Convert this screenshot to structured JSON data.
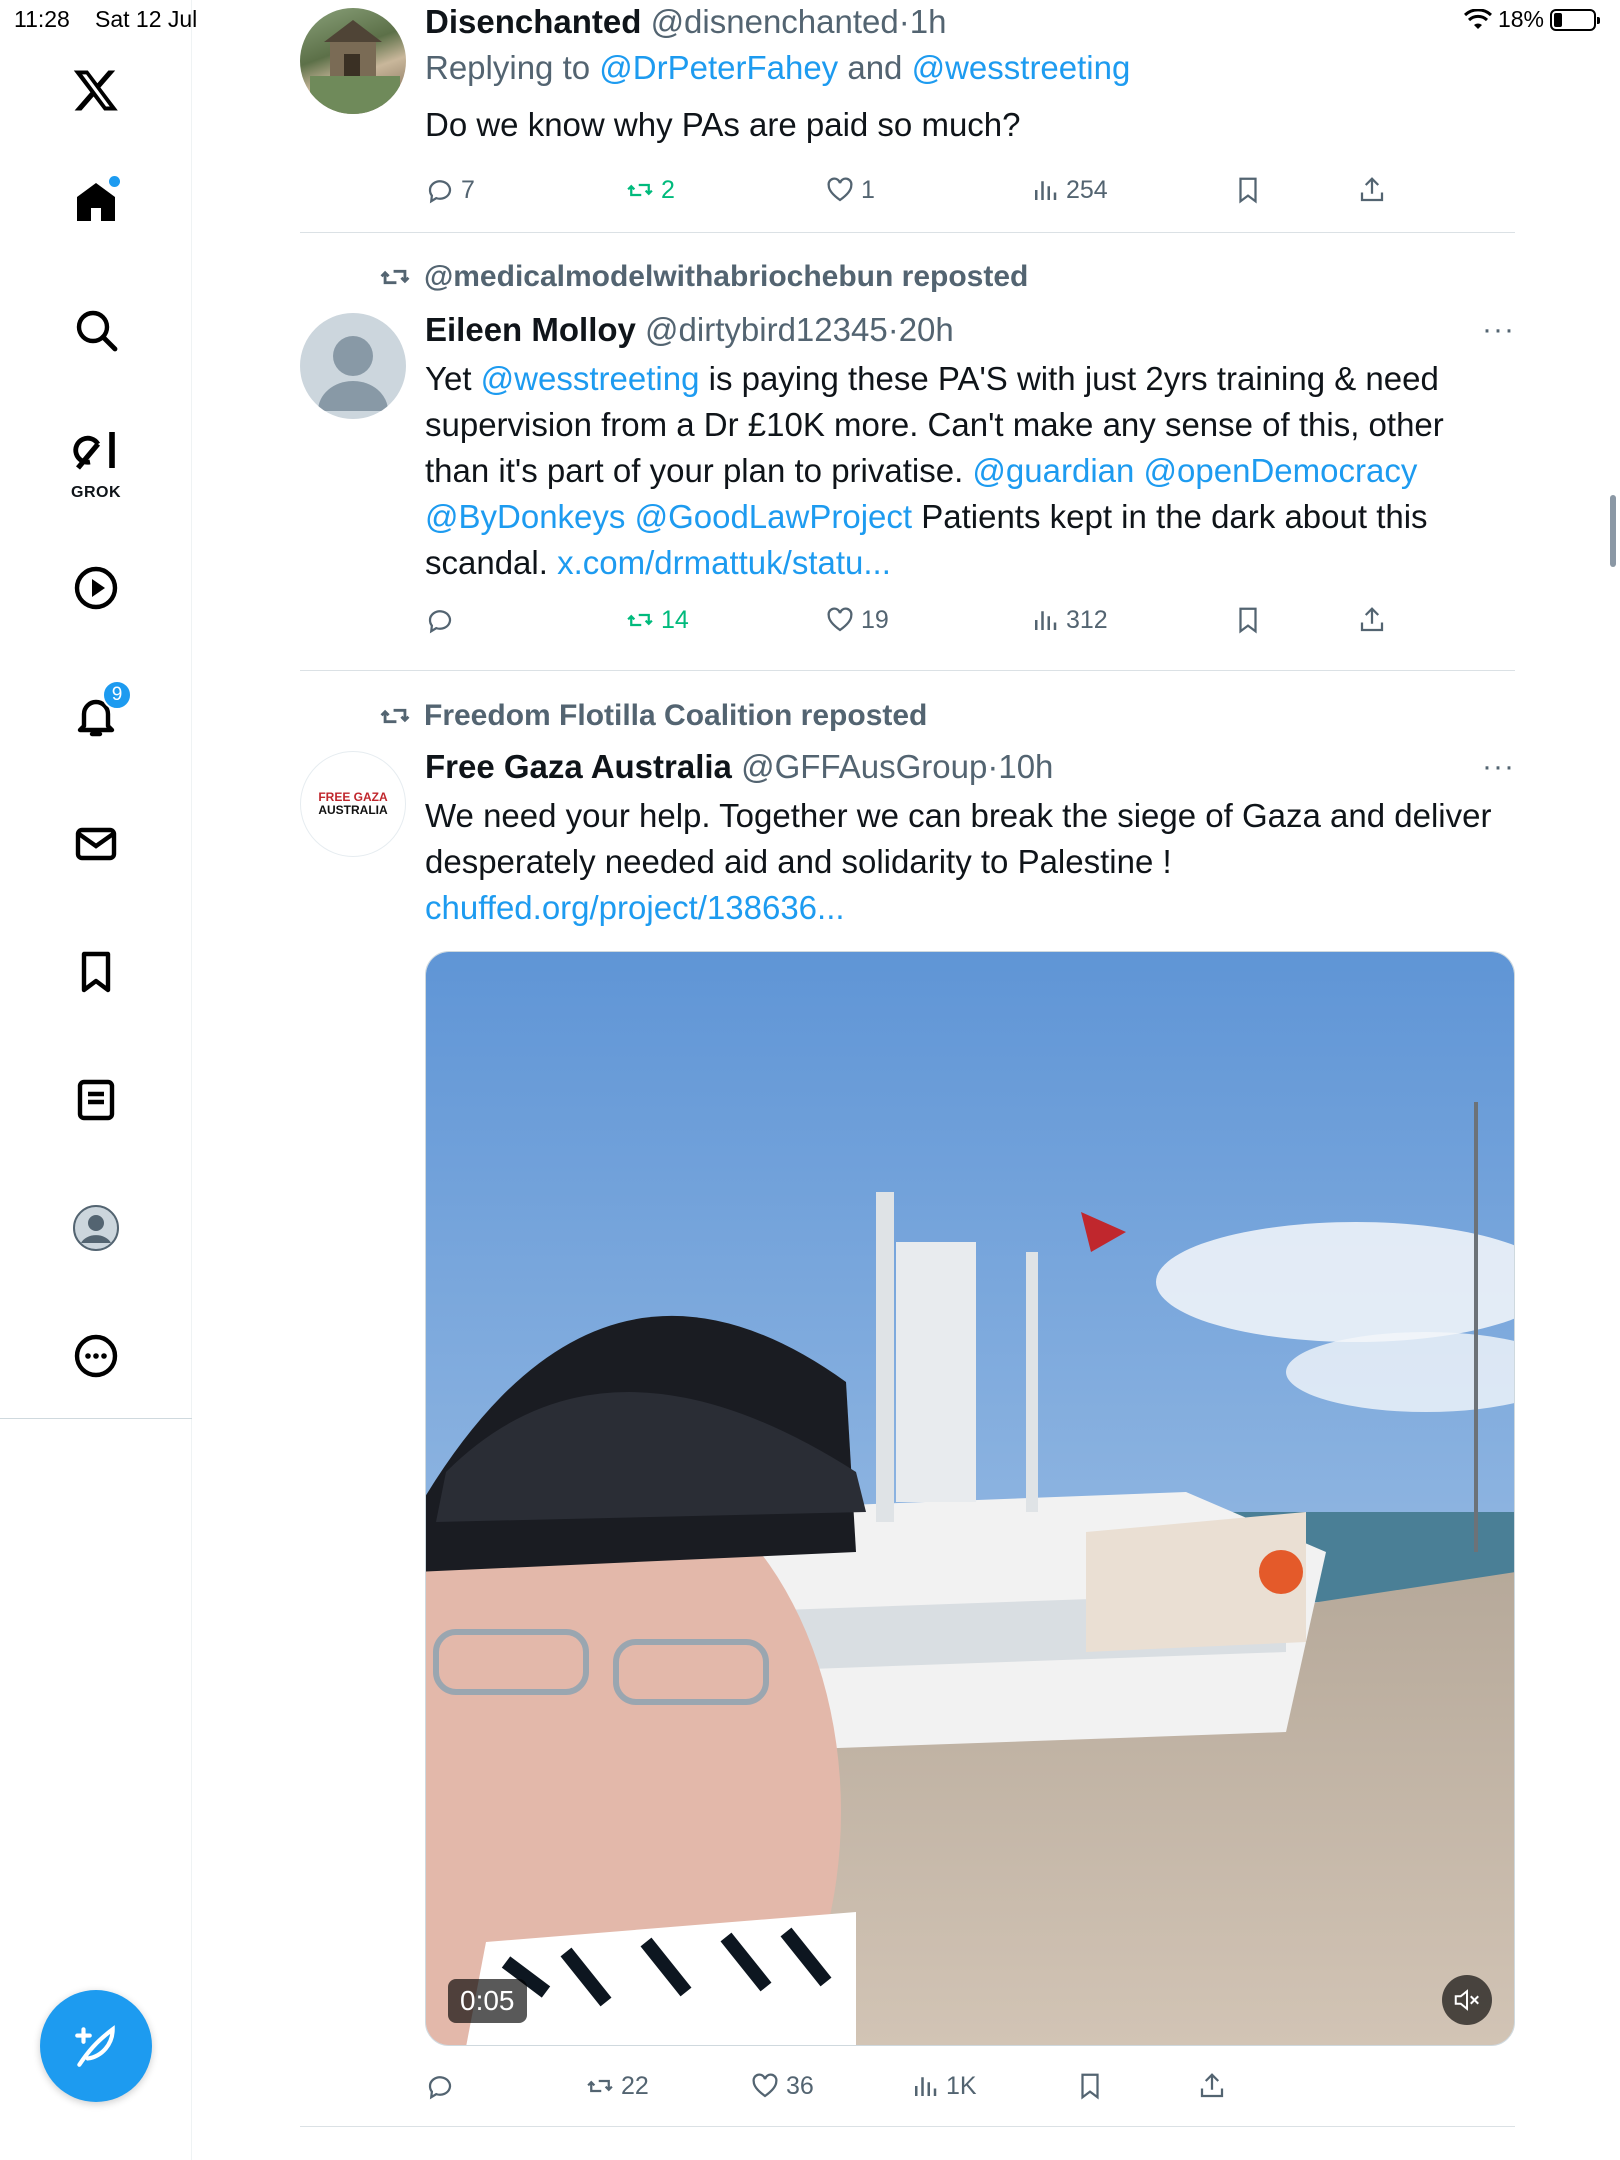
{
  "status_bar": {
    "time": "11:28",
    "date": "Sat 12 Jul",
    "battery": "18%",
    "wifi_icon": "wifi-icon"
  },
  "sidebar": {
    "items": [
      {
        "name": "x-logo",
        "icon": "x-logo-icon"
      },
      {
        "name": "home",
        "icon": "home-icon",
        "has_dot": true
      },
      {
        "name": "search",
        "icon": "search-icon"
      },
      {
        "name": "grok",
        "icon": "grok-icon",
        "label": "GROK"
      },
      {
        "name": "video",
        "icon": "play-icon"
      },
      {
        "name": "notifications",
        "icon": "bell-icon",
        "badge": "9"
      },
      {
        "name": "messages",
        "icon": "mail-icon"
      },
      {
        "name": "bookmarks",
        "icon": "bookmark-icon"
      },
      {
        "name": "lists",
        "icon": "list-icon"
      },
      {
        "name": "profile",
        "icon": "avatar-icon"
      },
      {
        "name": "more",
        "icon": "more-circle-icon"
      }
    ],
    "compose_icon": "compose-feather-icon"
  },
  "feed": {
    "tweets": [
      {
        "name": "Disenchanted",
        "handle": "@disnenchanted",
        "dot": "·",
        "age": "1h",
        "reply_prefix": "Replying to ",
        "reply_mention1": "@DrPeterFahey",
        "reply_and": " and ",
        "reply_mention2": "@wesstreeting",
        "text": "Do we know why PAs are paid so much?",
        "replies": "7",
        "reposts": "2",
        "likes": "1",
        "views": "254"
      },
      {
        "reposted_by": "@medicalmodelwithabriochebun reposted",
        "name": "Eileen Molloy",
        "handle": "@dirtybird12345",
        "dot": "·",
        "age": "20h",
        "more": "···",
        "t1": "Yet ",
        "m1": "@wesstreeting",
        "t2": " is paying these PA'S with just 2yrs training & need supervision from a Dr £10K more. Can't make any sense of this, other than it's part of your plan to privatise. ",
        "m2": "@guardian",
        "m3": "@openDemocracy",
        "m4": "@ByDonkeys",
        "m5": "@GoodLawProject",
        "t3": " Patients kept in the dark about this scandal. ",
        "url": "x.com/drmattuk/statu...",
        "replies": "",
        "reposts": "14",
        "likes": "19",
        "views": "312"
      },
      {
        "reposted_by": "Freedom Flotilla Coalition reposted",
        "name": "Free Gaza Australia",
        "handle": "@GFFAusGroup",
        "dot": "·",
        "age": "10h",
        "more": "···",
        "avatar_text1": "FREE GAZA",
        "avatar_text2": "AUSTRALIA",
        "t1": "We need your help. Together we can break the siege of Gaza and deliver desperately needed aid and solidarity to Palestine !  ",
        "url": "chuffed.org/project/138636...",
        "video_time": "0:05",
        "replies": "",
        "reposts": "22",
        "likes": "36",
        "views": "1K"
      }
    ]
  }
}
